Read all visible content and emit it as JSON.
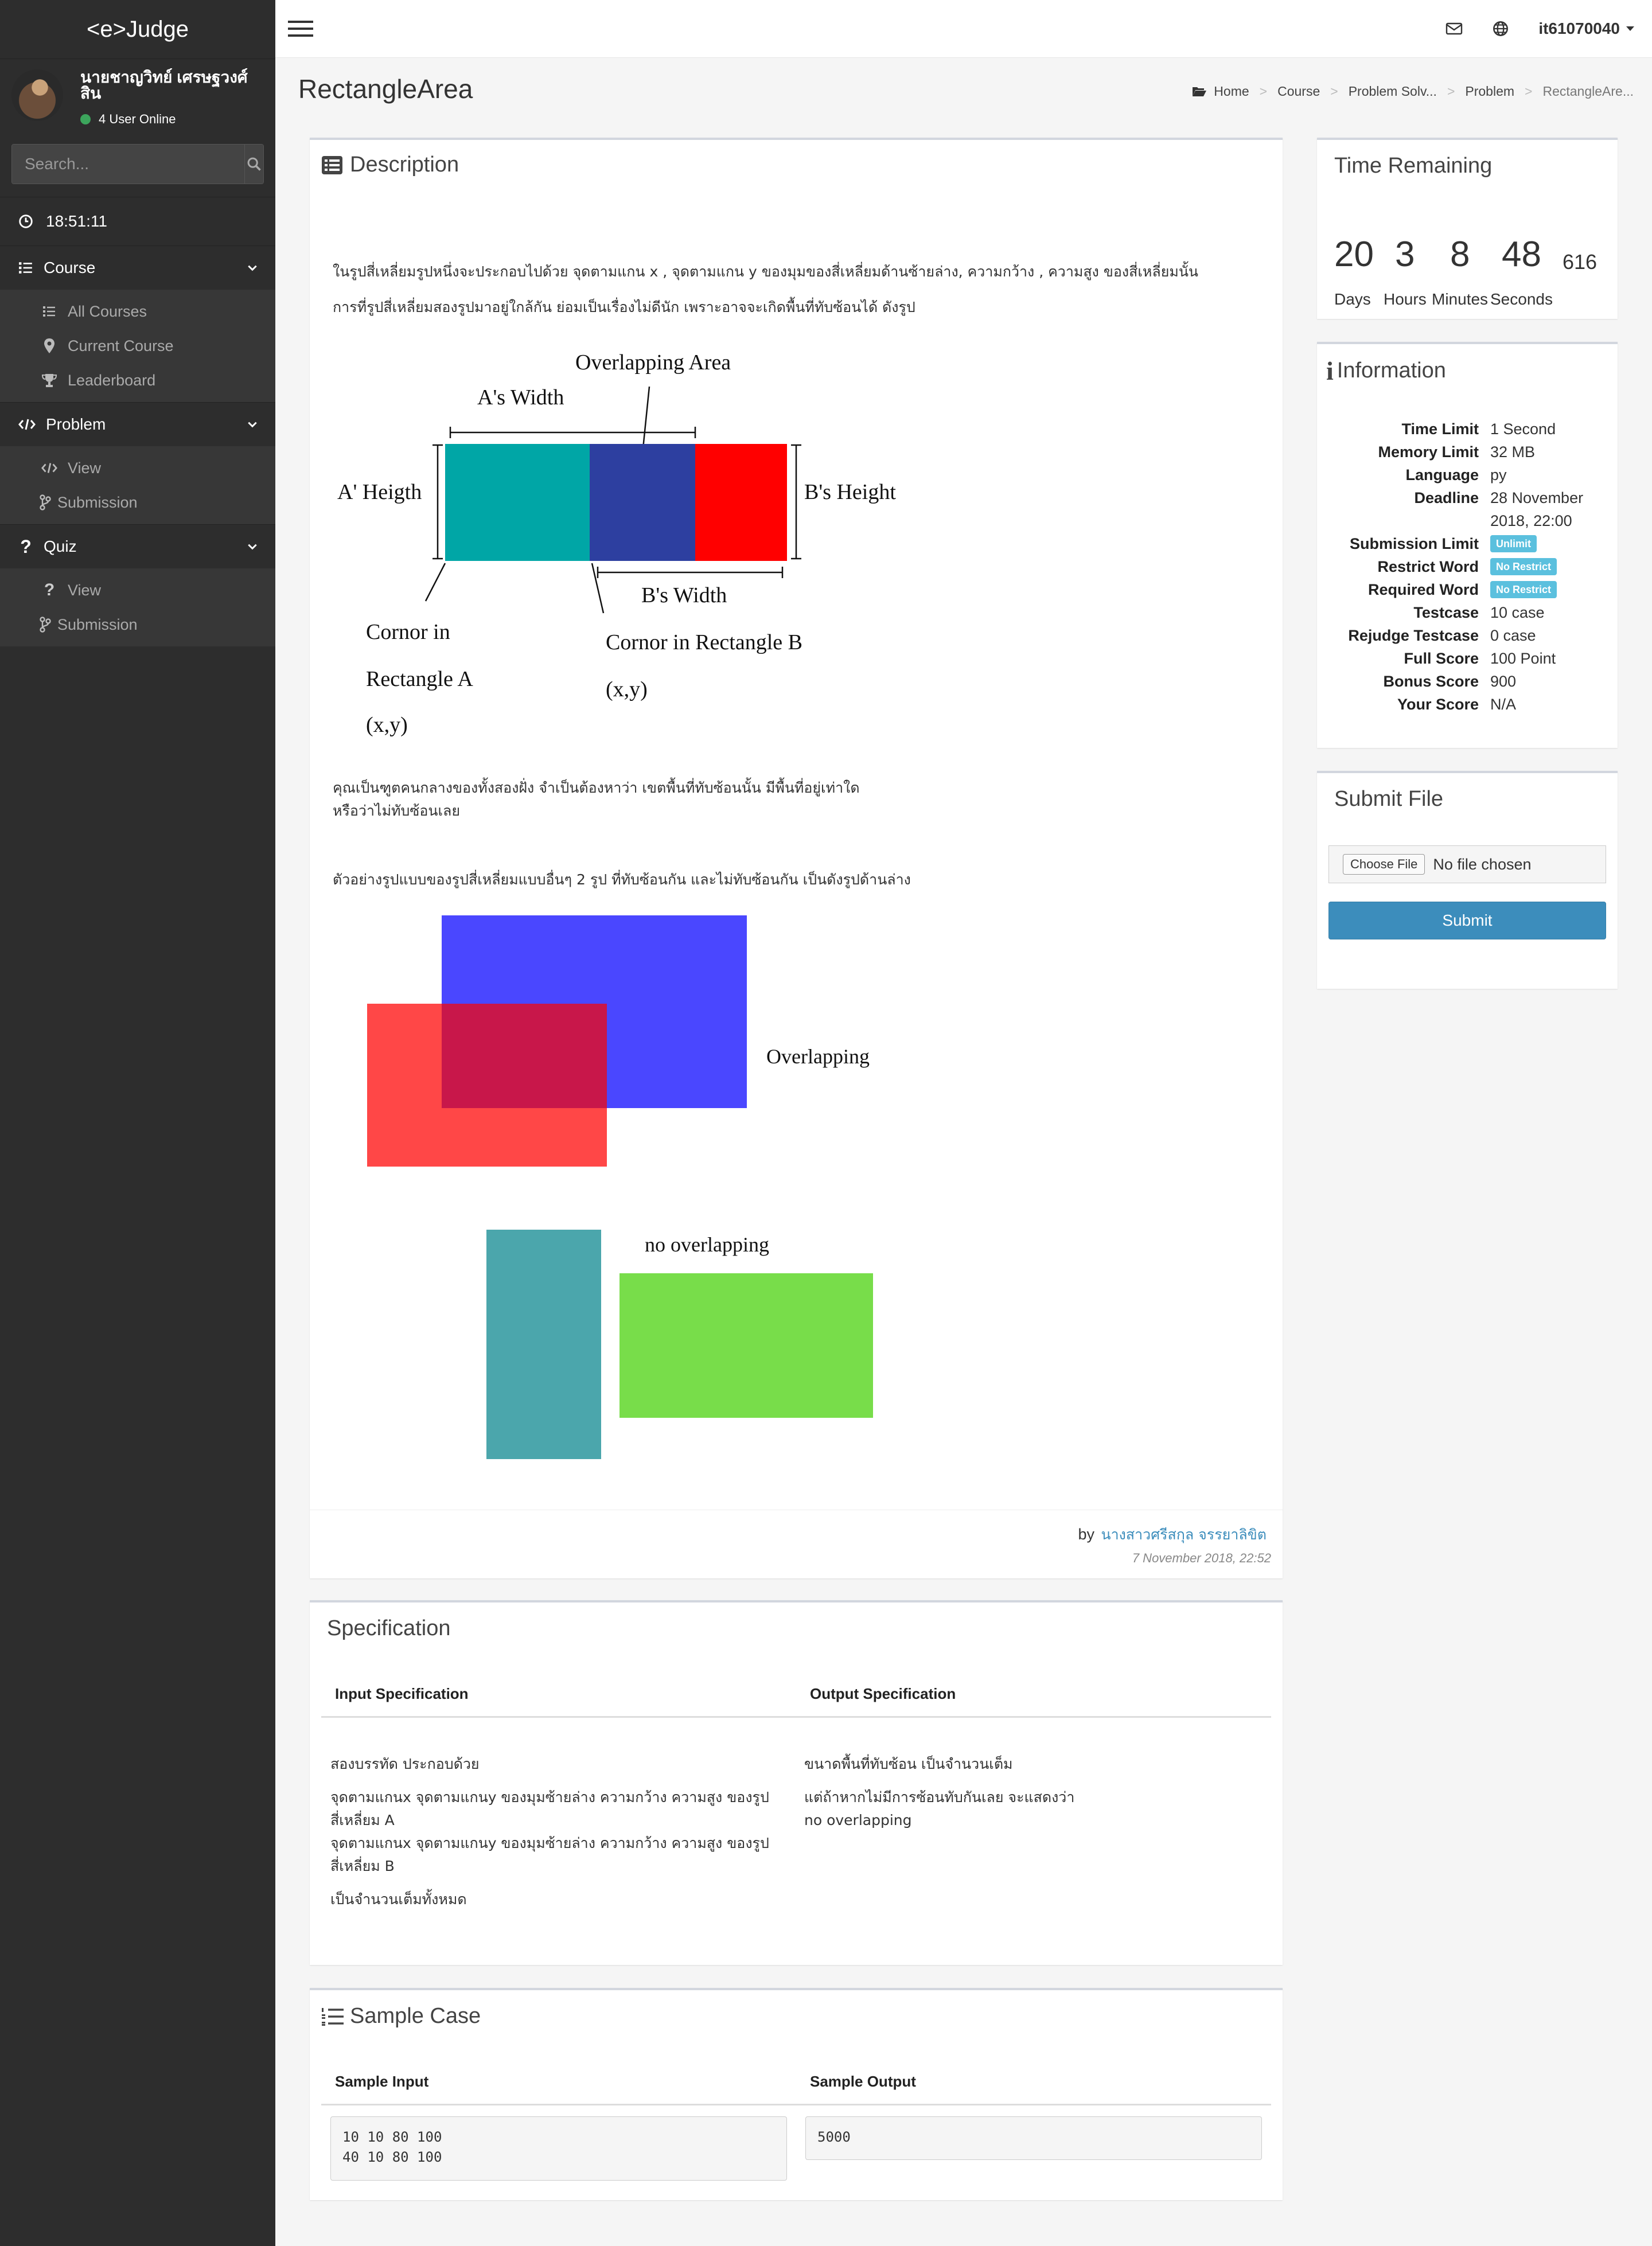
{
  "app": {
    "logo": "<e>Judge"
  },
  "user": {
    "name": "นายชาญวิทย์ เศรษฐวงศ์สิน",
    "online": "4 User Online"
  },
  "search": {
    "placeholder": "Search..."
  },
  "clock": "18:51:11",
  "nav": {
    "course": {
      "label": "Course",
      "items": [
        "All Courses",
        "Current Course",
        "Leaderboard"
      ]
    },
    "problem": {
      "label": "Problem",
      "items": [
        "View",
        "Submission"
      ]
    },
    "quiz": {
      "label": "Quiz",
      "items": [
        "View",
        "Submission"
      ]
    }
  },
  "topbar": {
    "user": "it61070040"
  },
  "page": {
    "title": "RectangleArea"
  },
  "breadcrumb": [
    "Home",
    "Course",
    "Problem Solv...",
    "Problem",
    "RectangleAre..."
  ],
  "description": {
    "title": "Description",
    "para1_line1": "ในรูปสี่เหลี่ยมรูปหนึ่งจะประกอบไปด้วย จุดตามแกน x , จุดตามแกน y ของมุมของสี่เหลี่ยมด้านซ้ายล่าง, ความกว้าง , ความสูง ของสี่เหลี่ยมนั้น",
    "para1_line2": "การที่รูปสี่เหลี่ยมสองรูปมาอยู่ใกล้กัน ย่อมเป็นเรื่องไม่ดีนัก เพราะอาจจะเกิดพื้นที่ทับซ้อนได้ ดังรูป",
    "fig1": {
      "overlap_label": "Overlapping Area",
      "a_width": "A's Width",
      "a_height": "A' Heigth",
      "b_height": "B's Height",
      "b_width": "B's Width",
      "corner_a_1": "Cornor in",
      "corner_a_2": "Rectangle A",
      "corner_a_3": "(x,y)",
      "corner_b_1": "Cornor in Rectangle B",
      "corner_b_2": "(x,y)",
      "colors": {
        "teal": "#00a6a6",
        "blue": "#2d3fa0",
        "red": "#ff0000"
      }
    },
    "para2_line1": "คุณเป็นฑูตคนกลางของทั้งสองฝั่ง จำเป็นต้องหาว่า เขตพื้นที่ทับซ้อนนั้น มีพื้นที่อยู่เท่าใด",
    "para2_line2": "หรือว่าไม่ทับซ้อนเลย",
    "para3": "ตัวอย่างรูปแบบของรูปสี่เหลี่ยมแบบอื่นๆ 2 รูป ที่ทับซ้อนกัน และไม่ทับซ้อนกัน เป็นดังรูปด้านล่าง",
    "fig2": {
      "overlapping": "Overlapping",
      "no_overlapping": "no overlapping",
      "colors": {
        "blue": "#4a47ff",
        "red": "#ff4747",
        "mix": "#c8174a",
        "teal": "#4ba6ac",
        "green": "#78dd4a"
      }
    },
    "by": "by",
    "author": "นางสาวศรีสกุล จรรยาลิขิต",
    "date": "7 November 2018, 22:52"
  },
  "time_remaining": {
    "title": "Time Remaining",
    "days": "20",
    "hours": "3",
    "minutes": "8",
    "seconds": "48",
    "ms": "616",
    "days_label": "Days",
    "hours_label": "Hours",
    "minutes_label": "Minutes",
    "seconds_label": "Seconds"
  },
  "information": {
    "title": "Information",
    "rows": [
      {
        "key": "Time Limit",
        "value": "1 Second"
      },
      {
        "key": "Memory Limit",
        "value": "32 MB"
      },
      {
        "key": "Language",
        "value": "py"
      },
      {
        "key": "Deadline",
        "value": "28 November 2018, 22:00"
      },
      {
        "key": "Submission Limit",
        "value": "Unlimit"
      },
      {
        "key": "Restrict Word",
        "value": "No Restrict"
      },
      {
        "key": "Required Word",
        "value": "No Restrict"
      },
      {
        "key": "Testcase",
        "value": "10 case"
      },
      {
        "key": "Rejudge Testcase",
        "value": "0 case"
      },
      {
        "key": "Full Score",
        "value": "100 Point"
      },
      {
        "key": "Bonus Score",
        "value": "900"
      },
      {
        "key": "Your Score",
        "value": "N/A"
      }
    ]
  },
  "submit_file": {
    "title": "Submit File",
    "choose": "Choose File",
    "no_file": "No file chosen",
    "submit": "Submit"
  },
  "specification": {
    "title": "Specification",
    "input_header": "Input Specification",
    "output_header": "Output Specification",
    "input_lines": [
      "สองบรรทัด ประกอบด้วย",
      "จุดตามแกนx จุดตามแกนy ของมุมซ้ายล่าง ความกว้าง ความสูง ของรูป",
      "สี่เหลี่ยม A",
      "จุดตามแกนx จุดตามแกนy ของมุมซ้ายล่าง ความกว้าง ความสูง ของรูป",
      "สี่เหลี่ยม B",
      "เป็นจำนวนเต็มทั้งหมด"
    ],
    "output_lines": [
      "ขนาดพื้นที่ทับซ้อน เป็นจำนวนเต็ม",
      "แต่ถ้าหากไม่มีการซ้อนทับกันเลย จะแสดงว่า",
      "no overlapping"
    ]
  },
  "sample": {
    "title": "Sample Case",
    "input_header": "Sample Input",
    "output_header": "Sample Output",
    "input": "10 10 80 100\n40 10 80 100",
    "output": "5000"
  }
}
